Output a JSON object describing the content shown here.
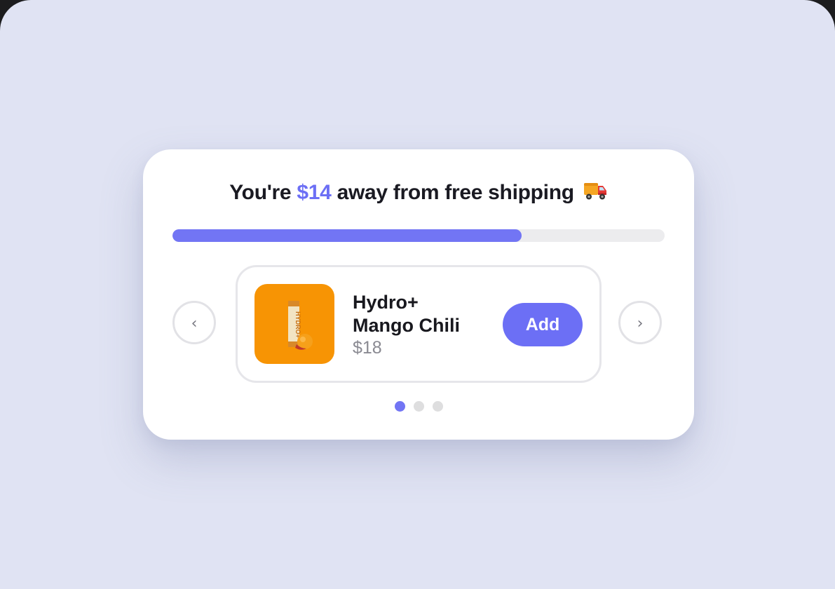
{
  "banner": {
    "prefix": "You're",
    "amount": "$14",
    "suffix": "away from free shipping",
    "icon": "delivery-truck-icon",
    "progress_fraction": 0.71,
    "accent_color": "#7275f4"
  },
  "carousel": {
    "prev_glyph": "‹",
    "next_glyph": "›",
    "product": {
      "name_line1": "Hydro+",
      "name_line2": "Mango Chili",
      "price": "$18",
      "image_label": "HYDRO+",
      "add_label": "Add"
    },
    "pages": 3,
    "active_page": 0
  }
}
